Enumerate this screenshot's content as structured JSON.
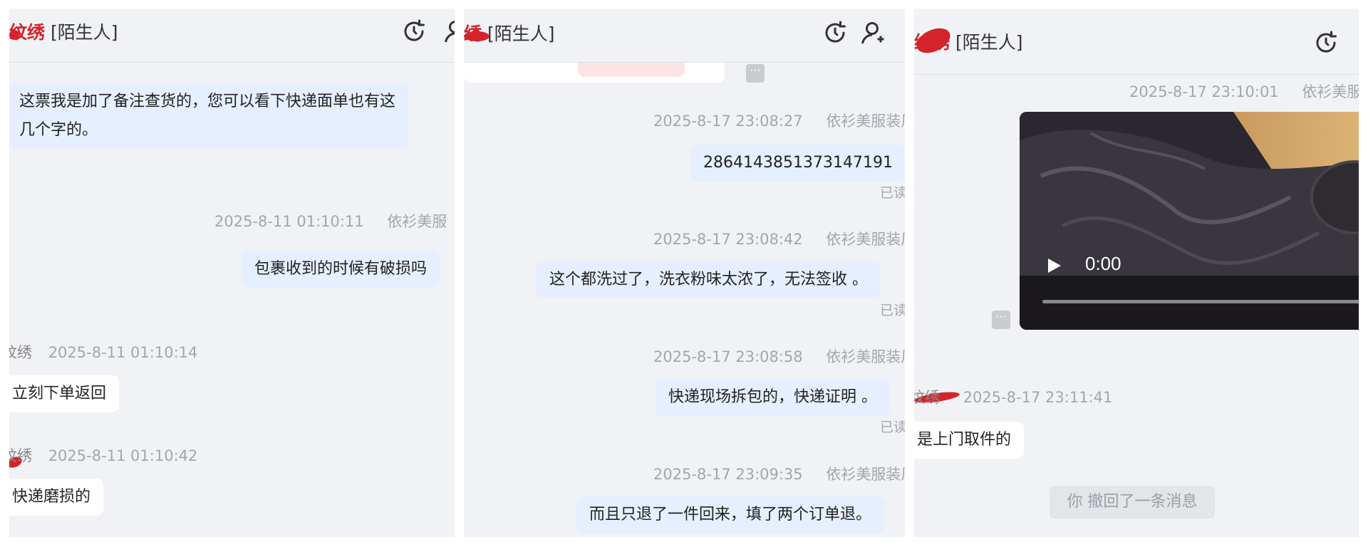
{
  "panels": [
    {
      "contact_name": "纹绣",
      "contact_tag": "[陌生人]",
      "messages": [
        {
          "text": "这票我是加了备注查货的，您可以看下快递面单也有这",
          "text2": "几个字的。"
        },
        {
          "time": "2025-8-11 01:10:11",
          "sender": "依衫美服",
          "text": "包裹收到的时候有破损吗"
        },
        {
          "sender": "纹绣",
          "time": "2025-8-11 01:10:14",
          "text": "立刻下单返回"
        },
        {
          "sender": "纹绣",
          "time": "2025-8-11 01:10:42",
          "text": "快递磨损的"
        }
      ]
    },
    {
      "contact_name": "绣",
      "contact_tag": "[陌生人]",
      "messages": [
        {
          "time": "2025-8-17 23:08:27",
          "sender": "依衫美服装厂",
          "text": "2864143851373147191",
          "status": "已读"
        },
        {
          "time": "2025-8-17 23:08:42",
          "sender": "依衫美服装厂",
          "text": "这个都洗过了，洗衣粉味太浓了，无法签收 。",
          "status": "已读"
        },
        {
          "time": "2025-8-17 23:08:58",
          "sender": "依衫美服装厂",
          "text": "快递现场拆包的，快递证明 。",
          "status": "已读"
        },
        {
          "time": "2025-8-17 23:09:35",
          "sender": "依衫美服装厂",
          "text": "而且只退了一件回来，填了两个订单退。"
        }
      ]
    },
    {
      "contact_name": "纹绣",
      "contact_tag": "[陌生人]",
      "video_msg": {
        "time": "2025-8-17 23:10:01",
        "sender": "依衫美服",
        "video_time": "0:00"
      },
      "incoming": {
        "sender": "纹绣",
        "time": "2025-8-17 23:11:41",
        "text": "是上门取件的"
      },
      "recall_notice": "你 撤回了一条消息"
    }
  ],
  "icons": {
    "refresh": "refresh-icon",
    "user": "user-icon",
    "more": "more-icon",
    "play": "play-icon"
  },
  "colors": {
    "panel_bg": "#f0f2f5",
    "outgoing_bubble": "#e6efff",
    "incoming_bubble": "#ffffff",
    "meta_text": "#a3a6ad",
    "redaction": "#d4232b"
  }
}
